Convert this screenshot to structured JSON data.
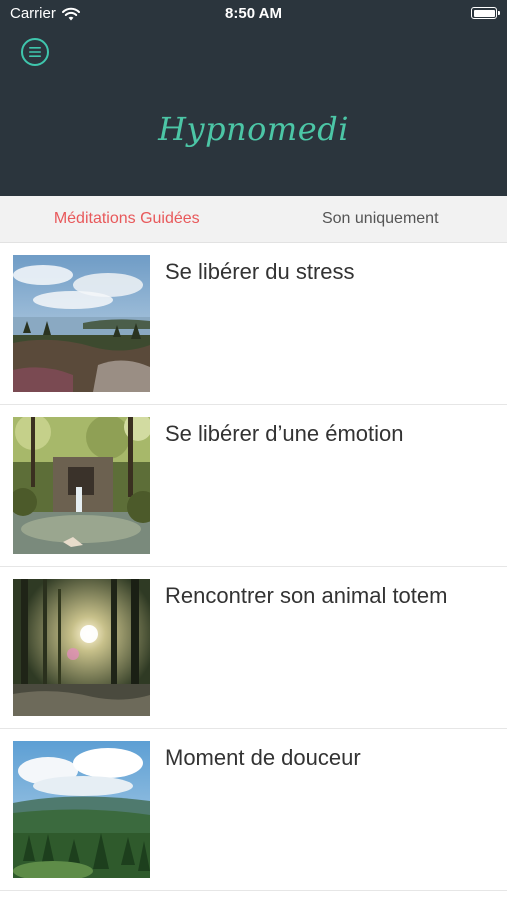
{
  "status_bar": {
    "carrier": "Carrier",
    "time": "8:50 AM",
    "icons": [
      "wifi-icon",
      "battery-icon"
    ]
  },
  "header": {
    "menu_icon": "hamburger-menu-icon",
    "title": "Hypnomedi",
    "background": "#2b353d",
    "accent": "#4cc6a6"
  },
  "tabs": [
    {
      "label": "Méditations Guidées",
      "active": true
    },
    {
      "label": "Son uniquement",
      "active": false
    }
  ],
  "tab_active_color": "#e8595b",
  "items": [
    {
      "title": "Se libérer du stress",
      "image": "coastal-lake-view-photo"
    },
    {
      "title": "Se libérer d’une émotion",
      "image": "forest-waterfall-photo"
    },
    {
      "title": "Rencontrer son animal totem",
      "image": "sunlit-forest-photo"
    },
    {
      "title": "Moment de douceur",
      "image": "forested-hills-sky-photo"
    }
  ]
}
